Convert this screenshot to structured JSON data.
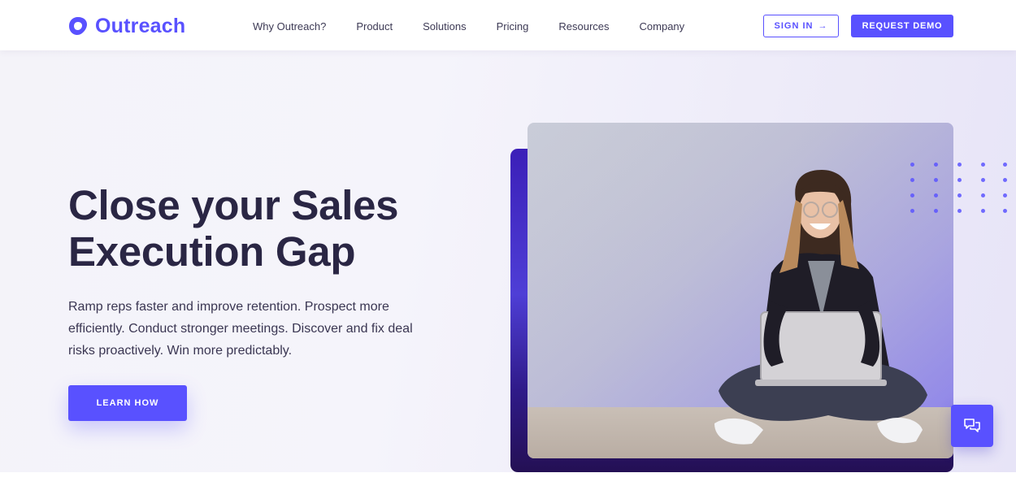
{
  "header": {
    "brand": "Outreach",
    "nav": [
      "Why Outreach?",
      "Product",
      "Solutions",
      "Pricing",
      "Resources",
      "Company"
    ],
    "signin_label": "SIGN IN",
    "signin_arrow": "→",
    "demo_label": "REQUEST DEMO"
  },
  "hero": {
    "title_line1": "Close your Sales",
    "title_line2": "Execution Gap",
    "subtitle_line1": "Ramp reps faster and improve retention. Prospect more",
    "subtitle_line2": "efficiently. Conduct stronger meetings. Discover and fix deal",
    "subtitle_line3": "risks proactively. Win more predictably.",
    "cta_label": "LEARN HOW"
  },
  "icons": {
    "logo": "outreach-logo-icon",
    "chat": "chat-bubbles-icon"
  },
  "colors": {
    "brand": "#5951ff",
    "heading": "#2a2644",
    "accent_dark": "#2f1a88"
  }
}
